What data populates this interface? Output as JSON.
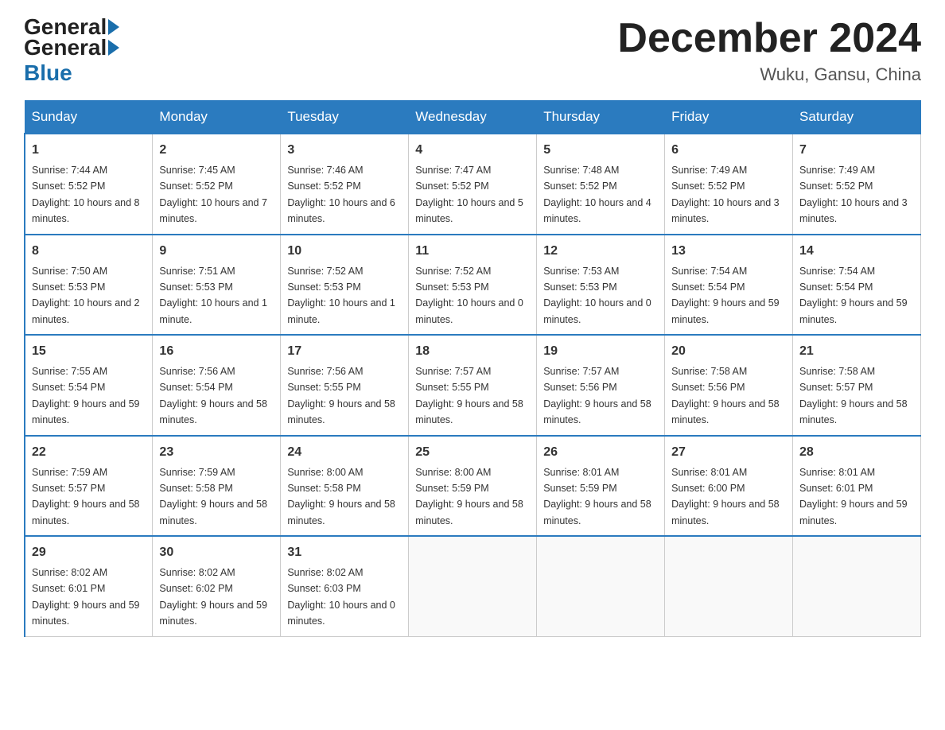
{
  "header": {
    "logo_general": "General",
    "logo_blue": "Blue",
    "title": "December 2024",
    "location": "Wuku, Gansu, China"
  },
  "days_of_week": [
    "Sunday",
    "Monday",
    "Tuesday",
    "Wednesday",
    "Thursday",
    "Friday",
    "Saturday"
  ],
  "weeks": [
    [
      {
        "num": "1",
        "sunrise": "7:44 AM",
        "sunset": "5:52 PM",
        "daylight": "10 hours and 8 minutes."
      },
      {
        "num": "2",
        "sunrise": "7:45 AM",
        "sunset": "5:52 PM",
        "daylight": "10 hours and 7 minutes."
      },
      {
        "num": "3",
        "sunrise": "7:46 AM",
        "sunset": "5:52 PM",
        "daylight": "10 hours and 6 minutes."
      },
      {
        "num": "4",
        "sunrise": "7:47 AM",
        "sunset": "5:52 PM",
        "daylight": "10 hours and 5 minutes."
      },
      {
        "num": "5",
        "sunrise": "7:48 AM",
        "sunset": "5:52 PM",
        "daylight": "10 hours and 4 minutes."
      },
      {
        "num": "6",
        "sunrise": "7:49 AM",
        "sunset": "5:52 PM",
        "daylight": "10 hours and 3 minutes."
      },
      {
        "num": "7",
        "sunrise": "7:49 AM",
        "sunset": "5:52 PM",
        "daylight": "10 hours and 3 minutes."
      }
    ],
    [
      {
        "num": "8",
        "sunrise": "7:50 AM",
        "sunset": "5:53 PM",
        "daylight": "10 hours and 2 minutes."
      },
      {
        "num": "9",
        "sunrise": "7:51 AM",
        "sunset": "5:53 PM",
        "daylight": "10 hours and 1 minute."
      },
      {
        "num": "10",
        "sunrise": "7:52 AM",
        "sunset": "5:53 PM",
        "daylight": "10 hours and 1 minute."
      },
      {
        "num": "11",
        "sunrise": "7:52 AM",
        "sunset": "5:53 PM",
        "daylight": "10 hours and 0 minutes."
      },
      {
        "num": "12",
        "sunrise": "7:53 AM",
        "sunset": "5:53 PM",
        "daylight": "10 hours and 0 minutes."
      },
      {
        "num": "13",
        "sunrise": "7:54 AM",
        "sunset": "5:54 PM",
        "daylight": "9 hours and 59 minutes."
      },
      {
        "num": "14",
        "sunrise": "7:54 AM",
        "sunset": "5:54 PM",
        "daylight": "9 hours and 59 minutes."
      }
    ],
    [
      {
        "num": "15",
        "sunrise": "7:55 AM",
        "sunset": "5:54 PM",
        "daylight": "9 hours and 59 minutes."
      },
      {
        "num": "16",
        "sunrise": "7:56 AM",
        "sunset": "5:54 PM",
        "daylight": "9 hours and 58 minutes."
      },
      {
        "num": "17",
        "sunrise": "7:56 AM",
        "sunset": "5:55 PM",
        "daylight": "9 hours and 58 minutes."
      },
      {
        "num": "18",
        "sunrise": "7:57 AM",
        "sunset": "5:55 PM",
        "daylight": "9 hours and 58 minutes."
      },
      {
        "num": "19",
        "sunrise": "7:57 AM",
        "sunset": "5:56 PM",
        "daylight": "9 hours and 58 minutes."
      },
      {
        "num": "20",
        "sunrise": "7:58 AM",
        "sunset": "5:56 PM",
        "daylight": "9 hours and 58 minutes."
      },
      {
        "num": "21",
        "sunrise": "7:58 AM",
        "sunset": "5:57 PM",
        "daylight": "9 hours and 58 minutes."
      }
    ],
    [
      {
        "num": "22",
        "sunrise": "7:59 AM",
        "sunset": "5:57 PM",
        "daylight": "9 hours and 58 minutes."
      },
      {
        "num": "23",
        "sunrise": "7:59 AM",
        "sunset": "5:58 PM",
        "daylight": "9 hours and 58 minutes."
      },
      {
        "num": "24",
        "sunrise": "8:00 AM",
        "sunset": "5:58 PM",
        "daylight": "9 hours and 58 minutes."
      },
      {
        "num": "25",
        "sunrise": "8:00 AM",
        "sunset": "5:59 PM",
        "daylight": "9 hours and 58 minutes."
      },
      {
        "num": "26",
        "sunrise": "8:01 AM",
        "sunset": "5:59 PM",
        "daylight": "9 hours and 58 minutes."
      },
      {
        "num": "27",
        "sunrise": "8:01 AM",
        "sunset": "6:00 PM",
        "daylight": "9 hours and 58 minutes."
      },
      {
        "num": "28",
        "sunrise": "8:01 AM",
        "sunset": "6:01 PM",
        "daylight": "9 hours and 59 minutes."
      }
    ],
    [
      {
        "num": "29",
        "sunrise": "8:02 AM",
        "sunset": "6:01 PM",
        "daylight": "9 hours and 59 minutes."
      },
      {
        "num": "30",
        "sunrise": "8:02 AM",
        "sunset": "6:02 PM",
        "daylight": "9 hours and 59 minutes."
      },
      {
        "num": "31",
        "sunrise": "8:02 AM",
        "sunset": "6:03 PM",
        "daylight": "10 hours and 0 minutes."
      },
      null,
      null,
      null,
      null
    ]
  ],
  "labels": {
    "sunrise_prefix": "Sunrise: ",
    "sunset_prefix": "Sunset: ",
    "daylight_prefix": "Daylight: "
  }
}
